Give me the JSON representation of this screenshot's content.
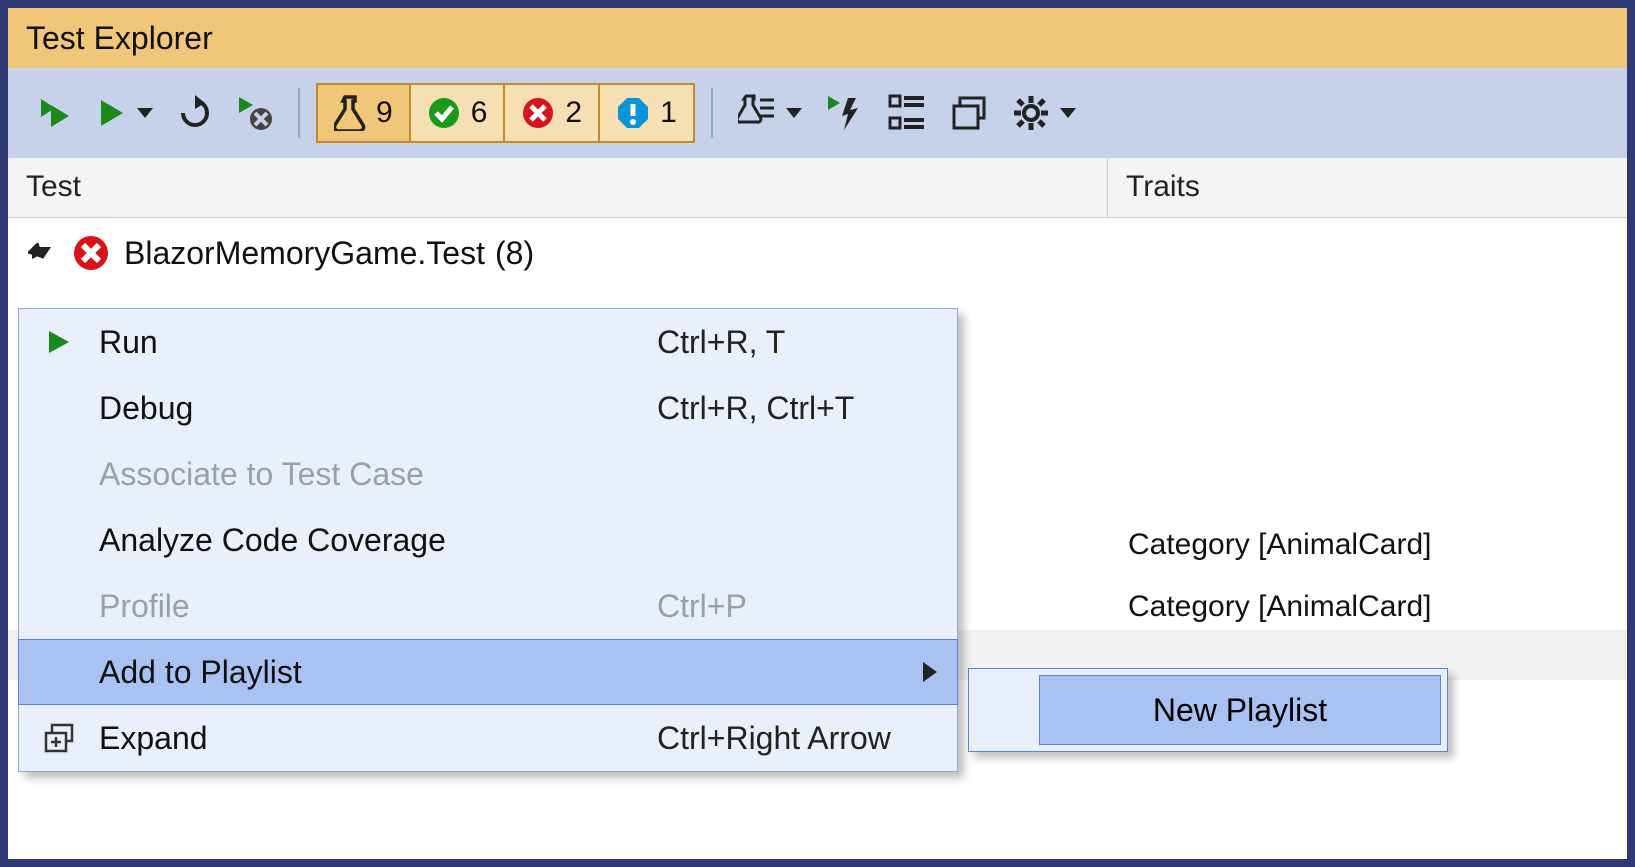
{
  "title": "Test Explorer",
  "counts": {
    "total": "9",
    "passed": "6",
    "failed": "2",
    "info": "1"
  },
  "columns": {
    "test": "Test",
    "traits": "Traits"
  },
  "tree": {
    "root_name": "BlazorMemoryGame.Test",
    "root_count": "(8)"
  },
  "traits": {
    "row1": "Category [AnimalCard]",
    "row2": "Category [AnimalCard]"
  },
  "menu": {
    "run": "Run",
    "run_sc": "Ctrl+R, T",
    "debug": "Debug",
    "debug_sc": "Ctrl+R, Ctrl+T",
    "associate": "Associate to Test Case",
    "analyze": "Analyze Code Coverage",
    "profile": "Profile",
    "profile_sc": "Ctrl+P",
    "add_playlist": "Add to Playlist",
    "expand": "Expand",
    "expand_sc": "Ctrl+Right Arrow"
  },
  "submenu": {
    "new_playlist": "New Playlist"
  }
}
